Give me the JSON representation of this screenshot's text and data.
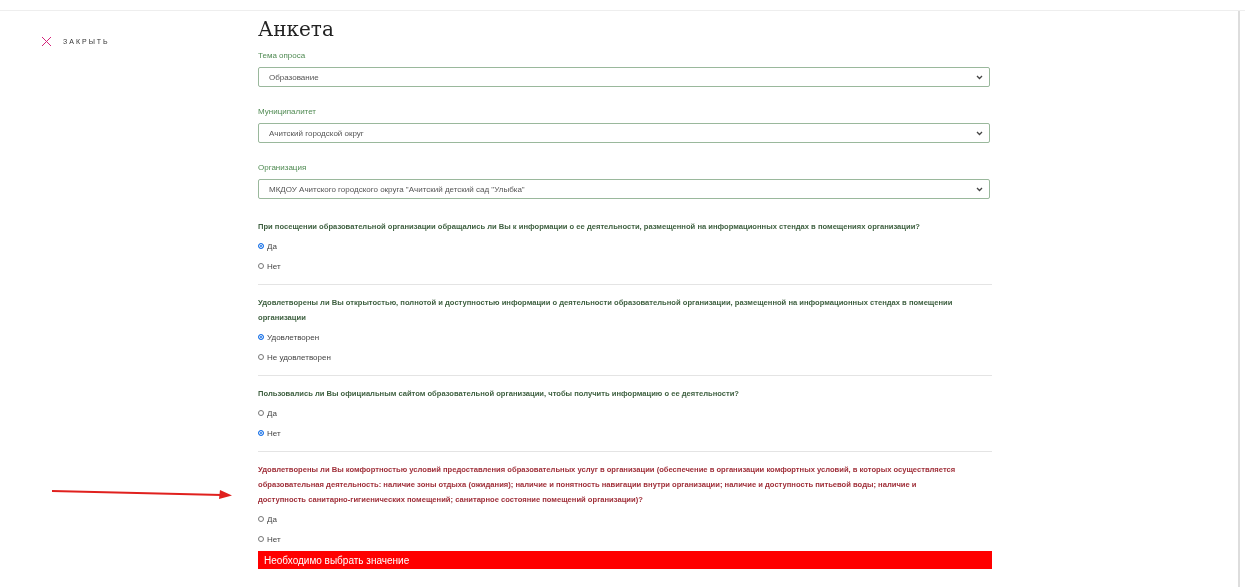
{
  "close": {
    "label": "ЗАКРЫТЬ"
  },
  "title": "Анкета",
  "selects": [
    {
      "label": "Тема опроса",
      "value": "Образование"
    },
    {
      "label": "Муниципалитет",
      "value": "Ачитский городской округ"
    },
    {
      "label": "Организация",
      "value": "МКДОУ Ачитского городского округа \"Ачитский детский сад \"Улыбка\""
    }
  ],
  "questions": [
    {
      "text": "При посещении образовательной организации обращались ли Вы к информации о ее деятельности, размещенной на информационных стендах в помещениях организации?",
      "error": false,
      "options": [
        {
          "label": "Да",
          "selected": true
        },
        {
          "label": "Нет",
          "selected": false
        }
      ]
    },
    {
      "text": "Удовлетворены ли Вы открытостью, полнотой и доступностью информации о деятельности образовательной организации, размещенной на информационных стендах в помещении организации",
      "error": false,
      "options": [
        {
          "label": "Удовлетворен",
          "selected": true
        },
        {
          "label": "Не удовлетворен",
          "selected": false
        }
      ]
    },
    {
      "text": "Пользовались ли Вы официальным сайтом образовательной организации, чтобы получить информацию о ее деятельности?",
      "error": false,
      "options": [
        {
          "label": "Да",
          "selected": false
        },
        {
          "label": "Нет",
          "selected": true
        }
      ]
    },
    {
      "text": "Удовлетворены ли Вы комфортностью условий предоставления образовательных услуг в организации (обеспечение в организации комфортных условий, в которых осуществляется образовательная деятельность: наличие зоны отдыха (ожидания); наличие и понятность навигации внутри организации; наличие и доступность питьевой воды; наличие и доступность санитарно-гигиенических помещений; санитарное состояние помещений организации)?",
      "error": true,
      "error_message": "Необходимо выбрать значение",
      "options": [
        {
          "label": "Да",
          "selected": false
        },
        {
          "label": "Нет",
          "selected": false
        }
      ]
    }
  ]
}
